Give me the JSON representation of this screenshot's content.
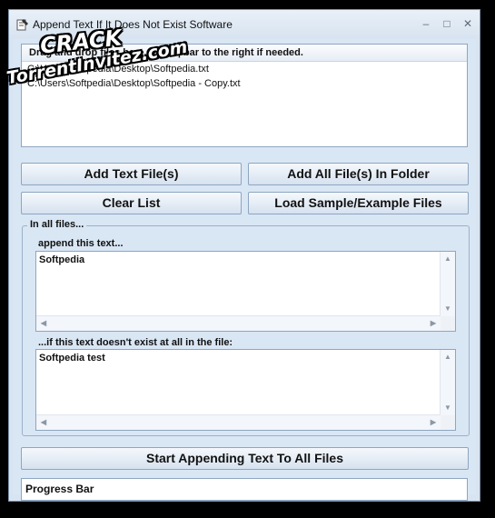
{
  "window": {
    "title": "Append Text If It Does Not Exist Software",
    "minimize_glyph": "–",
    "maximize_glyph": "□",
    "close_glyph": "✕"
  },
  "file_list": {
    "header": "Drag and drop files here. Move | bar to the right if needed.",
    "rows": [
      "C:\\Users\\Softpedia\\Desktop\\Softpedia.txt",
      "C:\\Users\\Softpedia\\Desktop\\Softpedia - Copy.txt"
    ]
  },
  "buttons": {
    "add_text_files": "Add Text File(s)",
    "add_all_in_folder": "Add All File(s) In Folder",
    "clear_list": "Clear List",
    "load_sample": "Load Sample/Example Files",
    "start": "Start Appending Text To All Files"
  },
  "group": {
    "legend": "In all files...",
    "append_label": "append this text...",
    "append_value": "Softpedia",
    "condition_label": "...if this text doesn't exist at all in the file:",
    "condition_value": "Softpedia test"
  },
  "progress": {
    "label": "Progress Bar"
  },
  "scroll_glyphs": {
    "up": "▲",
    "down": "▼",
    "left": "◀",
    "right": "▶"
  },
  "watermark": {
    "line1": "CRACK",
    "line2": "TorrentInvitez.com"
  },
  "colors": {
    "window_bg": "#d9e6f4",
    "border": "#8ea6c0",
    "background": "#000000"
  },
  "icons": [
    "app-icon",
    "minimize-icon",
    "maximize-icon",
    "close-icon"
  ]
}
